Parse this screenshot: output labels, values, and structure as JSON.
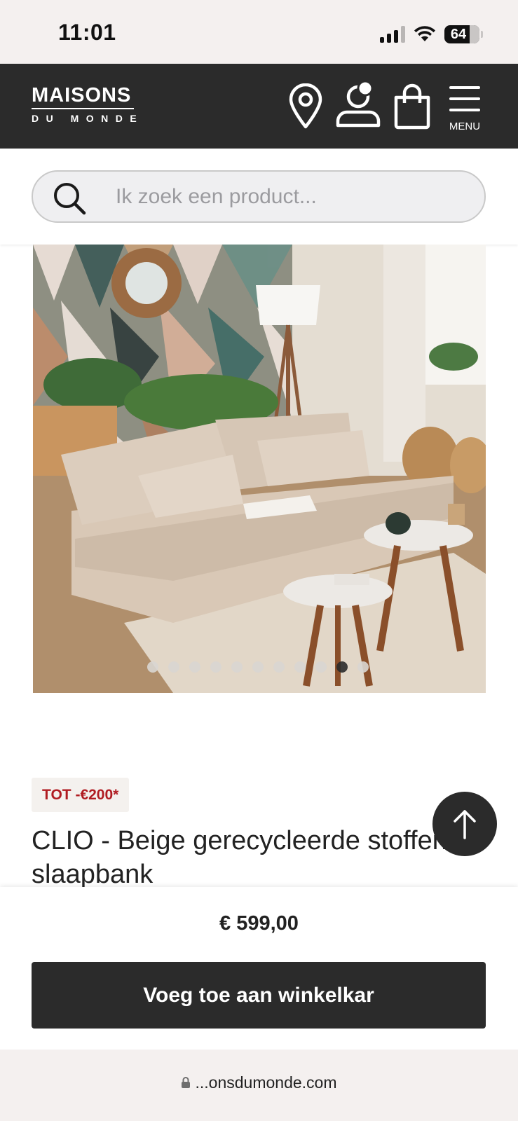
{
  "status_bar": {
    "time": "11:01",
    "battery": "64"
  },
  "header": {
    "logo_top": "MAISONS",
    "logo_bottom": "DU MONDE",
    "menu_label": "MENU"
  },
  "search": {
    "placeholder": "Ik zoek een product..."
  },
  "gallery": {
    "dot_count": 11,
    "active_index": 9
  },
  "product": {
    "promo": "TOT -€200*",
    "title": "CLIO - Beige gerecycleerde stoffen slaapbank",
    "price": "€ 599,00",
    "add_to_cart": "Voeg toe aan winkelkar"
  },
  "browser": {
    "url": "...onsdumonde.com"
  }
}
